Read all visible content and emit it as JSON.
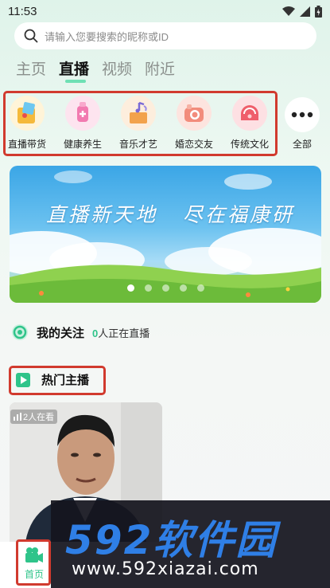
{
  "status": {
    "time": "11:53"
  },
  "search": {
    "placeholder": "请输入您要搜索的昵称或ID"
  },
  "tabs": [
    {
      "label": "主页",
      "active": false
    },
    {
      "label": "直播",
      "active": true
    },
    {
      "label": "视频",
      "active": false
    },
    {
      "label": "附近",
      "active": false
    }
  ],
  "categories": [
    {
      "label": "直播带货",
      "icon": "shopping-bag-icon",
      "color": "#f5c346"
    },
    {
      "label": "健康养生",
      "icon": "health-icon",
      "color": "#f27ab0"
    },
    {
      "label": "音乐才艺",
      "icon": "music-icon",
      "color": "#f2a24c"
    },
    {
      "label": "婚恋交友",
      "icon": "camera-icon",
      "color": "#f28c7c"
    },
    {
      "label": "传统文化",
      "icon": "culture-icon",
      "color": "#ef5f6b"
    }
  ],
  "more": {
    "label": "全部"
  },
  "banner": {
    "line1": "直播新天地",
    "line2": "尽在福康研",
    "slides": 5,
    "active_slide": 0
  },
  "follow": {
    "title": "我的关注",
    "count": "0",
    "suffix": "人正在直播"
  },
  "hot": {
    "title": "热门主播"
  },
  "card": {
    "viewers": "2人在看"
  },
  "nav": {
    "home_label": "首页"
  },
  "watermark": {
    "top": "592软件园",
    "bottom": "www.592xiazai.com"
  },
  "colors": {
    "accent": "#2fc48a",
    "highlight_box": "#d13a2e"
  }
}
